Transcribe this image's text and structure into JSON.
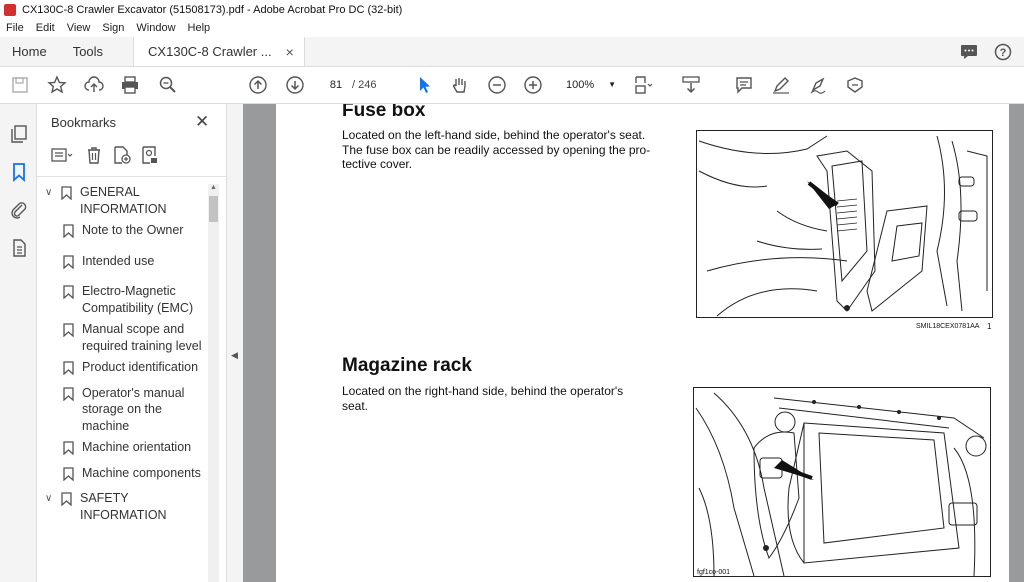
{
  "window": {
    "title": "CX130C-8 Crawler Excavator (51508173).pdf - Adobe Acrobat Pro DC (32-bit)"
  },
  "menu": [
    "File",
    "Edit",
    "View",
    "Sign",
    "Window",
    "Help"
  ],
  "tabs": {
    "home": "Home",
    "tools": "Tools",
    "document": "CX130C-8 Crawler ..."
  },
  "toolbar": {
    "page_current": "81",
    "page_total": "/ 246",
    "zoom": "100%"
  },
  "bookmarks": {
    "title": "Bookmarks",
    "items": [
      {
        "label": "GENERAL INFORMATION",
        "level": 0,
        "expanded": true
      },
      {
        "label": "Note to the Owner",
        "level": 1
      },
      {
        "label": "Intended use",
        "level": 1
      },
      {
        "label": "Electro-Magnetic Compatibility (EMC)",
        "level": 1
      },
      {
        "label": "Manual scope and required training level",
        "level": 1
      },
      {
        "label": "Product identification",
        "level": 1
      },
      {
        "label": "Operator's manual storage on the machine",
        "level": 1
      },
      {
        "label": "Machine orientation",
        "level": 1
      },
      {
        "label": "Machine components",
        "level": 1
      },
      {
        "label": "SAFETY INFORMATION",
        "level": 0,
        "expanded": true
      }
    ]
  },
  "document": {
    "section1": {
      "heading": "Fuse box",
      "lines": [
        "Located on the left-hand side, behind the operator's seat.",
        "The fuse box can be readily accessed by opening the pro-",
        "tective cover."
      ],
      "figure_code": "SMIL18CEX0781AA",
      "figure_number": "1"
    },
    "section2": {
      "heading": "Magazine rack",
      "lines": [
        "Located on the right-hand side, behind the operator's",
        "seat."
      ],
      "figure_code": "fgf1co-001"
    }
  },
  "colors": {
    "accent": "#1473e6",
    "pdf_red": "#d32f2f",
    "viewer_bg": "#999a9c"
  }
}
